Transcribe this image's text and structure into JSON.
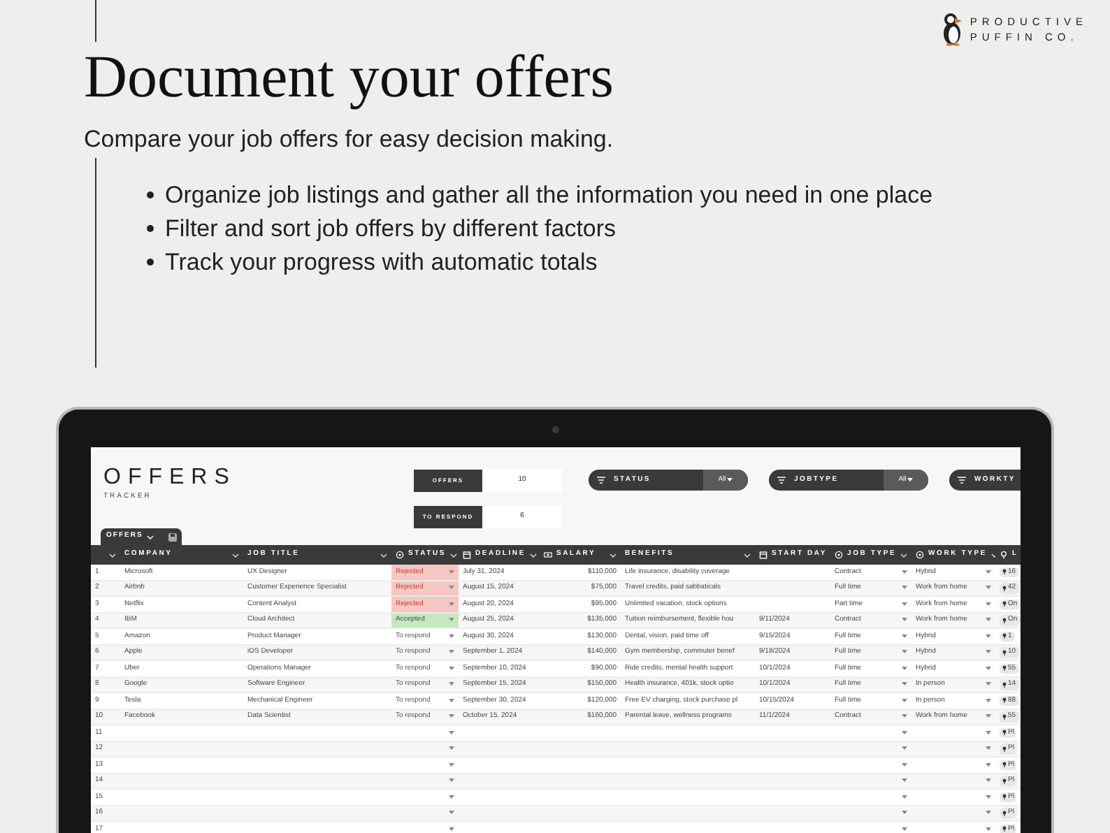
{
  "brand": {
    "line_1": "PRODUCTIVE",
    "line_2": "PUFFIN CO."
  },
  "headline": "Document your offers",
  "subtitle": "Compare your job offers for easy decision making.",
  "bullets": [
    "Organize job listings and gather all the information you need in one place",
    "Filter and sort job offers by different factors",
    "Track your progress with automatic totals"
  ],
  "tracker": {
    "title": "OFFERS",
    "subtitle": "TRACKER",
    "stats": [
      {
        "label": "OFFERS",
        "value": "10"
      },
      {
        "label": "TO RESPOND",
        "value": "6"
      }
    ],
    "filters": [
      {
        "label": "STATUS",
        "value": "All"
      },
      {
        "label": "JOBTYPE",
        "value": "All"
      },
      {
        "label": "WORKTY"
      }
    ],
    "sheet_tab": "OFFERS",
    "columns": [
      "",
      "COMPANY",
      "JOB TITLE",
      "STATUS",
      "DEADLINE",
      "SALARY",
      "BENEFITS",
      "START DAY",
      "JOB TYPE",
      "WORK TYPE",
      "L"
    ],
    "rows": [
      {
        "number": "1",
        "company": "Microsoft",
        "job_title": "UX Designer",
        "status": {
          "text": "Rejected",
          "kind": "rejected"
        },
        "deadline": "July 31, 2024",
        "salary": "$110,000",
        "benefits": "Life insurance, disability coverage",
        "job_type": "Contract",
        "work_type": "Hybrid",
        "location": "16"
      },
      {
        "number": "2",
        "company": "Airbnb",
        "job_title": "Customer Experience Specialist",
        "status": {
          "text": "Rejected",
          "kind": "rejected"
        },
        "deadline": "August 15, 2024",
        "salary": "$75,000",
        "benefits": "Travel credits, paid sabbaticals",
        "job_type": "Full time",
        "work_type": "Work from home",
        "location": "42"
      },
      {
        "number": "3",
        "company": "Netflix",
        "job_title": "Content Analyst",
        "status": {
          "text": "Rejected",
          "kind": "rejected"
        },
        "deadline": "August 20, 2024",
        "salary": "$95,000",
        "benefits": "Unlimited vacation, stock options",
        "job_type": "Part time",
        "work_type": "Work from home",
        "location": "On"
      },
      {
        "number": "4",
        "company": "IBM",
        "job_title": "Cloud Architect",
        "status": {
          "text": "Accepted",
          "kind": "accepted"
        },
        "deadline": "August 25, 2024",
        "salary": "$135,000",
        "benefits": "Tuition reimbursement, flexible hou",
        "start_day": "9/11/2024",
        "job_type": "Contract",
        "work_type": "Work from home",
        "location": "On"
      },
      {
        "number": "5",
        "company": "Amazon",
        "job_title": "Product Manager",
        "status": {
          "text": "To respond",
          "kind": "pending"
        },
        "deadline": "August 30, 2024",
        "salary": "$130,000",
        "benefits": "Dental, vision, paid time off",
        "start_day": "9/15/2024",
        "job_type": "Full time",
        "work_type": "Hybrid",
        "location": "1"
      },
      {
        "number": "6",
        "company": "Apple",
        "job_title": "iOS Developer",
        "status": {
          "text": "To respond",
          "kind": "pending"
        },
        "deadline": "September 1, 2024",
        "salary": "$140,000",
        "benefits": "Gym membership, commuter benef",
        "start_day": "9/18/2024",
        "job_type": "Full time",
        "work_type": "Hybrid",
        "location": "10"
      },
      {
        "number": "7",
        "company": "Uber",
        "job_title": "Operations Manager",
        "status": {
          "text": "To respond",
          "kind": "pending"
        },
        "deadline": "September 10, 2024",
        "salary": "$90,000",
        "benefits": "Ride credits, mental health support",
        "start_day": "10/1/2024",
        "job_type": "Full time",
        "work_type": "Hybrid",
        "location": "55"
      },
      {
        "number": "8",
        "company": "Google",
        "job_title": "Software Engineer",
        "status": {
          "text": "To respond",
          "kind": "pending"
        },
        "deadline": "September 15, 2024",
        "salary": "$150,000",
        "benefits": "Health insurance, 401k, stock optio",
        "start_day": "10/1/2024",
        "job_type": "Full time",
        "work_type": "In person",
        "location": "14"
      },
      {
        "number": "9",
        "company": "Tesla",
        "job_title": "Mechanical Engineer",
        "status": {
          "text": "To respond",
          "kind": "pending"
        },
        "deadline": "September 30, 2024",
        "salary": "$120,000",
        "benefits": "Free EV charging, stock purchase pl",
        "start_day": "10/15/2024",
        "job_type": "Full time",
        "work_type": "In person",
        "location": "88"
      },
      {
        "number": "10",
        "company": "Facebook",
        "job_title": "Data Scientist",
        "status": {
          "text": "To respond",
          "kind": "pending"
        },
        "deadline": "October 15, 2024",
        "salary": "$160,000",
        "benefits": "Parental leave, wellness programs",
        "start_day": "11/1/2024",
        "job_type": "Contract",
        "work_type": "Work from home",
        "location": "55"
      },
      {
        "number": "11",
        "location": "Pl"
      },
      {
        "number": "12",
        "location": "Pl"
      },
      {
        "number": "13",
        "location": "Pl"
      },
      {
        "number": "14",
        "location": "Pl"
      },
      {
        "number": "15",
        "location": "Pl"
      },
      {
        "number": "16",
        "location": "Pl"
      },
      {
        "number": "17",
        "location": "Pl"
      }
    ]
  }
}
